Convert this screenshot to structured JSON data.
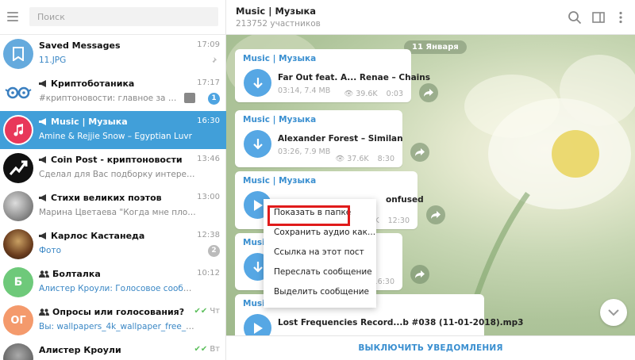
{
  "sidebar": {
    "search_placeholder": "Поиск",
    "chats": [
      {
        "name": "Saved Messages",
        "time": "17:09",
        "preview": "11.JPG",
        "preview_highlight": true,
        "pinned": true
      },
      {
        "name": "Криптоботаника",
        "time": "17:17",
        "preview": "#криптоновости: главное за день",
        "badge": "1",
        "is_channel": true
      },
      {
        "name": "Music | Музыка",
        "time": "16:30",
        "preview": "Amine & Rejjie Snow – Egyptian Luvr",
        "is_channel": true,
        "active": true
      },
      {
        "name": "Coin Post - криптоновости",
        "time": "13:46",
        "preview": "Сделал для Вас подборку интересных статей...",
        "is_channel": true
      },
      {
        "name": "Стихи великих поэтов",
        "time": "13:00",
        "preview": "Марина Цветаева \"Когда мне плохо — дума...",
        "is_channel": true
      },
      {
        "name": "Карлос Кастанеда",
        "time": "12:38",
        "preview": "Фото",
        "preview_highlight": true,
        "badge": "2",
        "badge_muted": true,
        "is_channel": true
      },
      {
        "name": "Болталка",
        "time": "10:12",
        "preview": "Алистер Кроули: Голосовое сообщение",
        "preview_highlight": true,
        "is_group": true,
        "avatar_letter": "Б"
      },
      {
        "name": "Опросы или голосования?",
        "time": "Чт",
        "preview": "Вы: wallpapers_4k_wallpaper_free_blue.jpg",
        "preview_highlight": true,
        "is_group": true,
        "avatar_letter": "ОГ",
        "read": true
      },
      {
        "name": "Алистер Кроули",
        "time": "Вт",
        "preview": "",
        "read": true
      }
    ]
  },
  "header": {
    "title": "Music | Музыка",
    "subtitle": "213752 участников"
  },
  "date_badge": "11 Января",
  "messages": [
    {
      "channel": "Music | Музыка",
      "title": "Far Out feat. A... Renae – Chains",
      "meta": "03:14, 7.4 MB",
      "views": "39.6K",
      "time": "0:03"
    },
    {
      "channel": "Music | Музыка",
      "title": "Alexander Forest – Similan",
      "meta": "03:26, 7.9 MB",
      "views": "37.6K",
      "time": "8:30"
    },
    {
      "channel": "Music | Музыка",
      "title": "onfused",
      "meta": "",
      "views": "6K",
      "time": "12:30"
    },
    {
      "channel": "Music | Музыка",
      "title": "",
      "meta": "",
      "views": "",
      "time": "16:30"
    },
    {
      "channel": "Music",
      "title": "Lost Frequencies Record...b #038 (11-01-2018).mp3",
      "meta": "",
      "views": "",
      "time": ""
    }
  ],
  "context_menu": {
    "items": [
      "Показать в папке",
      "Сохранить аудио как...",
      "Ссылка на этот пост",
      "Переслать сообщение",
      "Выделить сообщение"
    ]
  },
  "bottom_bar": {
    "label": "ВЫКЛЮЧИТЬ УВЕДОМЛЕНИЯ"
  },
  "colors": {
    "accent": "#419fd9",
    "link": "#3a8fd0",
    "highlight_box": "#e01b1b"
  }
}
